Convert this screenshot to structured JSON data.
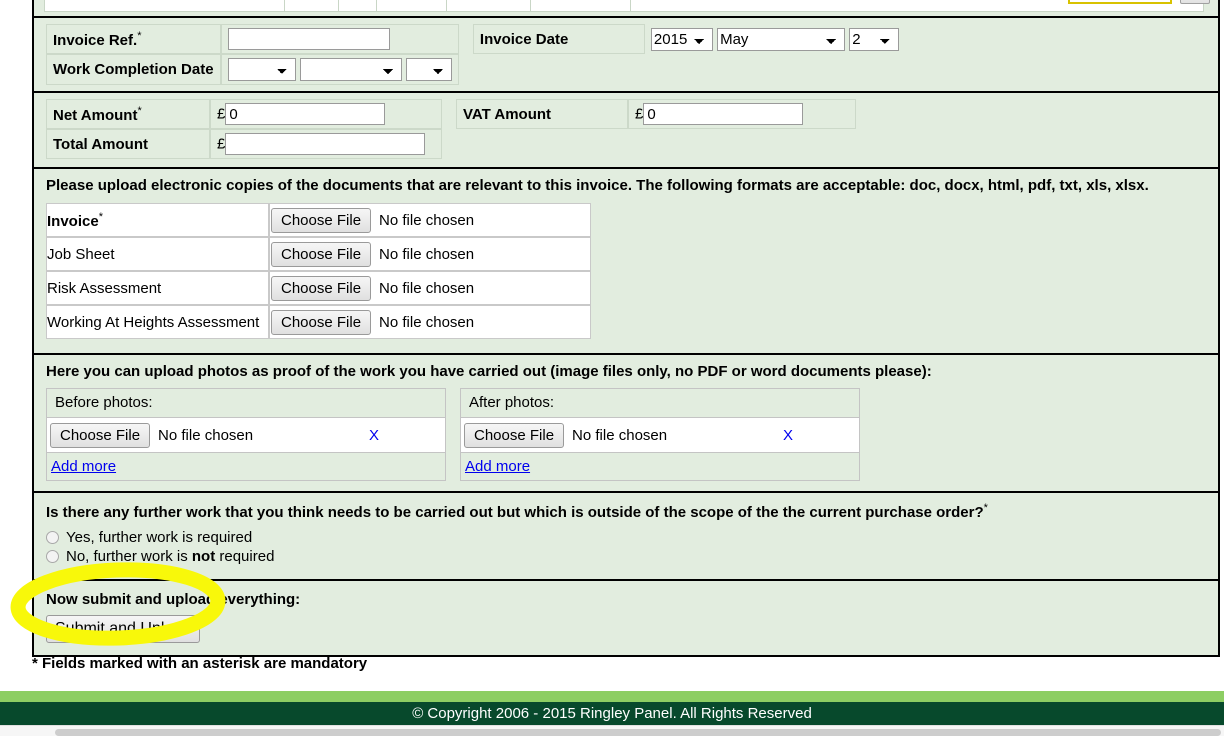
{
  "colors": {
    "panel_bg": "#e2eddf",
    "section_border": "#000000",
    "link": "#0000ee",
    "footer_light": "#8dce63",
    "footer_dark": "#07492c",
    "annotation": "#f8f80a"
  },
  "invoice_section": {
    "invoice_ref_label": "Invoice Ref.",
    "invoice_ref_required": "*",
    "invoice_ref_value": "",
    "work_completion_label": "Work Completion Date",
    "work_completion_day": "",
    "work_completion_month": "",
    "work_completion_year": "",
    "invoice_date_label": "Invoice Date",
    "invoice_date_year": "2015",
    "invoice_date_month": "May",
    "invoice_date_day": "2"
  },
  "amount_section": {
    "net_amount_label": "Net Amount",
    "net_amount_required": "*",
    "net_currency": "£",
    "net_amount_value": "0",
    "total_amount_label": "Total Amount",
    "total_currency": "£",
    "total_amount_value": "",
    "vat_amount_label": "VAT Amount",
    "vat_currency": "£",
    "vat_amount_value": "0"
  },
  "documents_section": {
    "note": "Please upload electronic copies of the documents that are relevant to this invoice. The following formats are acceptable: doc, docx, html, pdf, txt, xls, xlsx.",
    "choose_file_label": "Choose File",
    "no_file_label": "No file chosen",
    "rows": [
      {
        "label": "Invoice",
        "required": "*",
        "bold": true
      },
      {
        "label": "Job Sheet",
        "required": "",
        "bold": false
      },
      {
        "label": "Risk Assessment",
        "required": "",
        "bold": false
      },
      {
        "label": "Working At Heights Assessment",
        "required": "",
        "bold": false
      }
    ]
  },
  "photos_section": {
    "note": "Here you can upload photos as proof of the work you have carried out (image files only, no PDF or word documents please):",
    "choose_file_label": "Choose File",
    "no_file_label": "No file chosen",
    "remove_label": "X",
    "add_more_label": "Add more",
    "before_heading": "Before photos:",
    "after_heading": "After photos:"
  },
  "question_section": {
    "question": "Is there any further work that you think needs to be carried out but which is outside of the scope of the the current purchase order?",
    "question_required": "*",
    "option_yes": "Yes, further work is required",
    "option_no_prefix": "No, further work is ",
    "option_no_emphasis": "not",
    "option_no_suffix": " required"
  },
  "submit_section": {
    "note": "Now submit and upload everything:",
    "button_label": "Submit and Upload"
  },
  "mandatory_note": "* Fields marked with an asterisk are mandatory",
  "footer": {
    "copyright": "© Copyright 2006 - 2015 Ringley Panel. All Rights Reserved"
  }
}
